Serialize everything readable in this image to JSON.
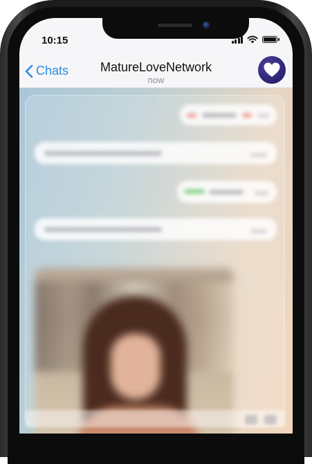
{
  "status_bar": {
    "time": "10:15"
  },
  "header": {
    "back_label": "Chats",
    "title": "MatureLoveNetwork",
    "subtitle": "now"
  },
  "icons": {
    "back": "chevron-left-icon",
    "avatar": "heart-icon",
    "signal": "cellular-signal-icon",
    "wifi": "wifi-icon",
    "battery": "battery-icon"
  },
  "colors": {
    "accent": "#2c8ae0",
    "avatar_bg": "#2b2370",
    "battery_level": 1.0
  },
  "chat": {
    "messages": [
      {
        "side": "outgoing",
        "text_visible": false
      },
      {
        "side": "incoming",
        "text_visible": false
      },
      {
        "side": "outgoing",
        "text_visible": false
      },
      {
        "side": "incoming",
        "text_visible": false
      },
      {
        "side": "incoming",
        "type": "photo"
      }
    ]
  }
}
